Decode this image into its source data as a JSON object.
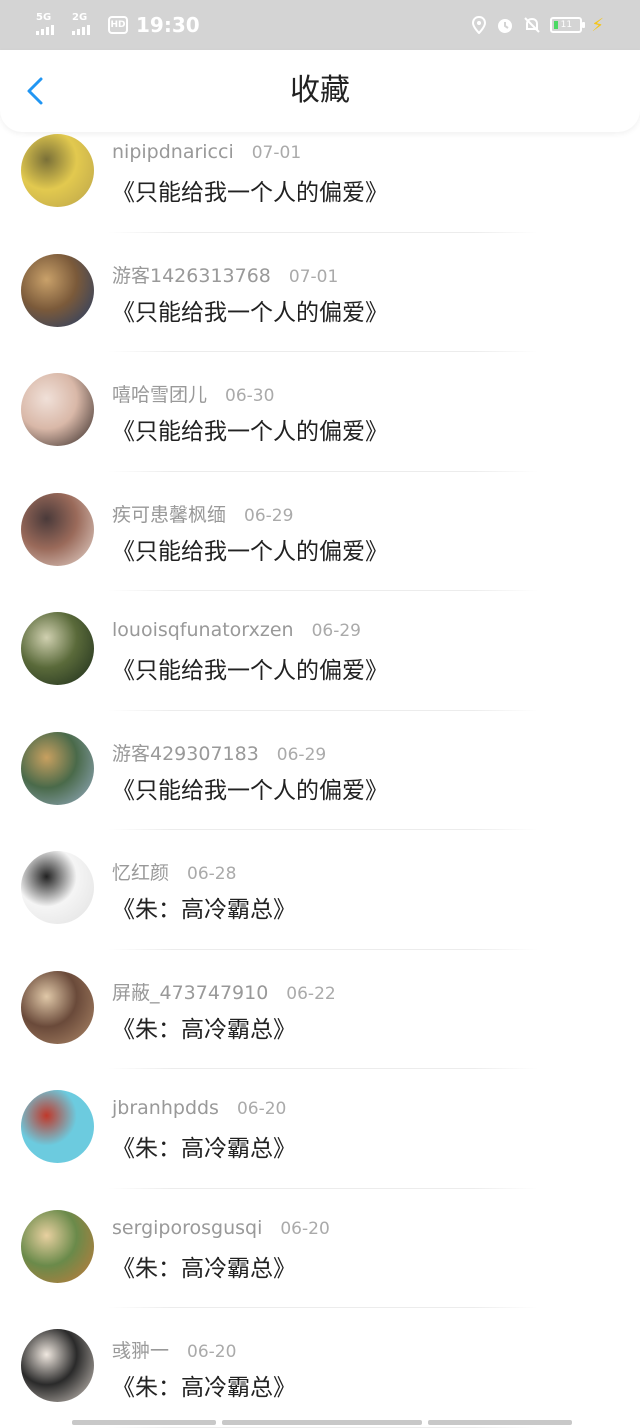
{
  "status_bar": {
    "network1": "5G",
    "network2": "2G",
    "hd": "HD",
    "time": "19:30",
    "battery": "11",
    "icons": [
      "location-icon",
      "alarm-icon",
      "mute-icon",
      "battery-icon",
      "charging-icon"
    ]
  },
  "header": {
    "title": "收藏",
    "back_icon": "chevron-left-icon",
    "accent": "#2196f3"
  },
  "items": [
    {
      "user": "nipipdnaricci",
      "date": "07-01",
      "book": "《只能给我一个人的偏爱》",
      "avatar_colors": [
        "#b9a24a",
        "#e2c94f",
        "#7a7038"
      ]
    },
    {
      "user": "游客1426313768",
      "date": "07-01",
      "book": "《只能给我一个人的偏爱》",
      "avatar_colors": [
        "#1f3b6b",
        "#7b5a3a",
        "#c9a16a"
      ]
    },
    {
      "user": "嘻哈雪团儿",
      "date": "06-30",
      "book": "《只能给我一个人的偏爱》",
      "avatar_colors": [
        "#2b2220",
        "#d9b8a8",
        "#f0e0d8"
      ]
    },
    {
      "user": "疾可患馨枫缅",
      "date": "06-29",
      "book": "《只能给我一个人的偏爱》",
      "avatar_colors": [
        "#e8d8d0",
        "#9a6a5a",
        "#4a3a3a"
      ]
    },
    {
      "user": "louoisqfunatorxzen",
      "date": "06-29",
      "book": "《只能给我一个人的偏爱》",
      "avatar_colors": [
        "#1a2a1a",
        "#5a6a3a",
        "#d0d0b0"
      ]
    },
    {
      "user": "游客429307183",
      "date": "06-29",
      "book": "《只能给我一个人的偏爱》",
      "avatar_colors": [
        "#9ab0c8",
        "#4a6a4a",
        "#c8a060"
      ]
    },
    {
      "user": "忆红颜",
      "date": "06-28",
      "book": "《朱：高冷霸总》",
      "avatar_colors": [
        "#e0e0e0",
        "#f5f5f5",
        "#222222"
      ]
    },
    {
      "user": "屏蔽_473747910",
      "date": "06-22",
      "book": "《朱：高冷霸总》",
      "avatar_colors": [
        "#b08a6a",
        "#6a4a3a",
        "#e0c8a8"
      ]
    },
    {
      "user": "jbranhpdds",
      "date": "06-20",
      "book": "《朱：高冷霸总》",
      "avatar_colors": [
        "#6ccbdf",
        "#6ccbdf",
        "#c0392b"
      ]
    },
    {
      "user": "sergiporosgusqi",
      "date": "06-20",
      "book": "《朱：高冷霸总》",
      "avatar_colors": [
        "#c87a3a",
        "#6a8a4a",
        "#e8d0a0"
      ]
    },
    {
      "user": "彧翀一",
      "date": "06-20",
      "book": "《朱：高冷霸总》",
      "avatar_colors": [
        "#d8d0c8",
        "#2a2a2a",
        "#f0e8e0"
      ]
    }
  ]
}
